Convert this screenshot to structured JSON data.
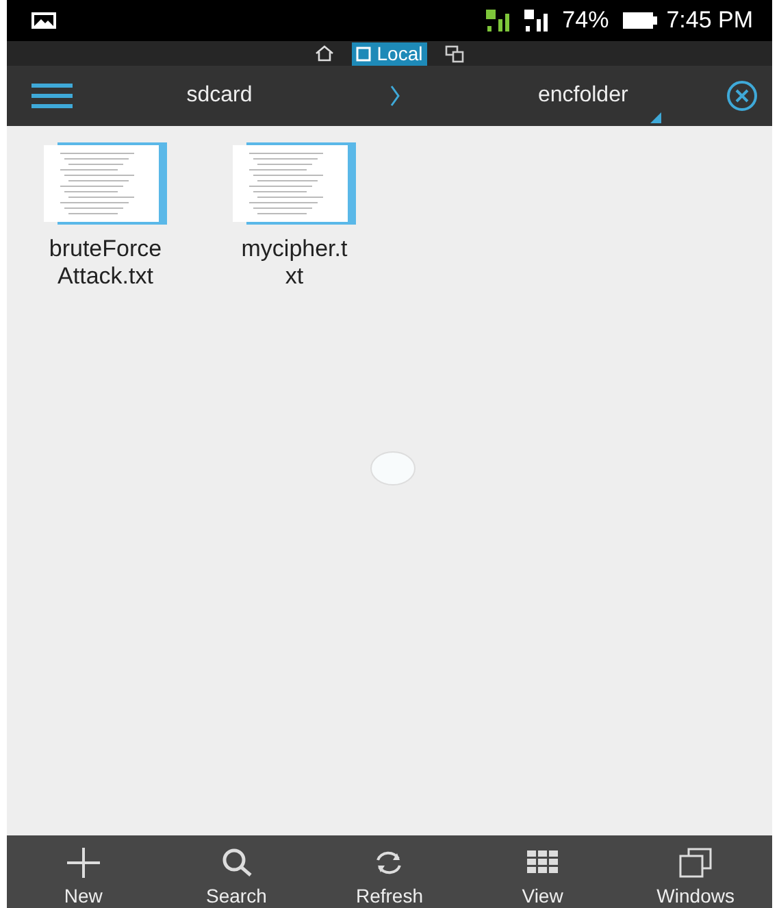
{
  "status_bar": {
    "battery": "74%",
    "time": "7:45 PM"
  },
  "location_tabs": [
    {
      "kind": "home",
      "selected": false
    },
    {
      "kind": "local",
      "label": "Local",
      "selected": true
    },
    {
      "kind": "network",
      "selected": false
    }
  ],
  "breadcrumb": [
    "sdcard",
    "encfolder"
  ],
  "files": [
    {
      "name": "bruteForceAttack.txt"
    },
    {
      "name": "mycipher.txt"
    }
  ],
  "toolbar": [
    {
      "kind": "new",
      "label": "New"
    },
    {
      "kind": "search",
      "label": "Search"
    },
    {
      "kind": "refresh",
      "label": "Refresh"
    },
    {
      "kind": "view",
      "label": "View"
    },
    {
      "kind": "windows",
      "label": "Windows"
    }
  ]
}
